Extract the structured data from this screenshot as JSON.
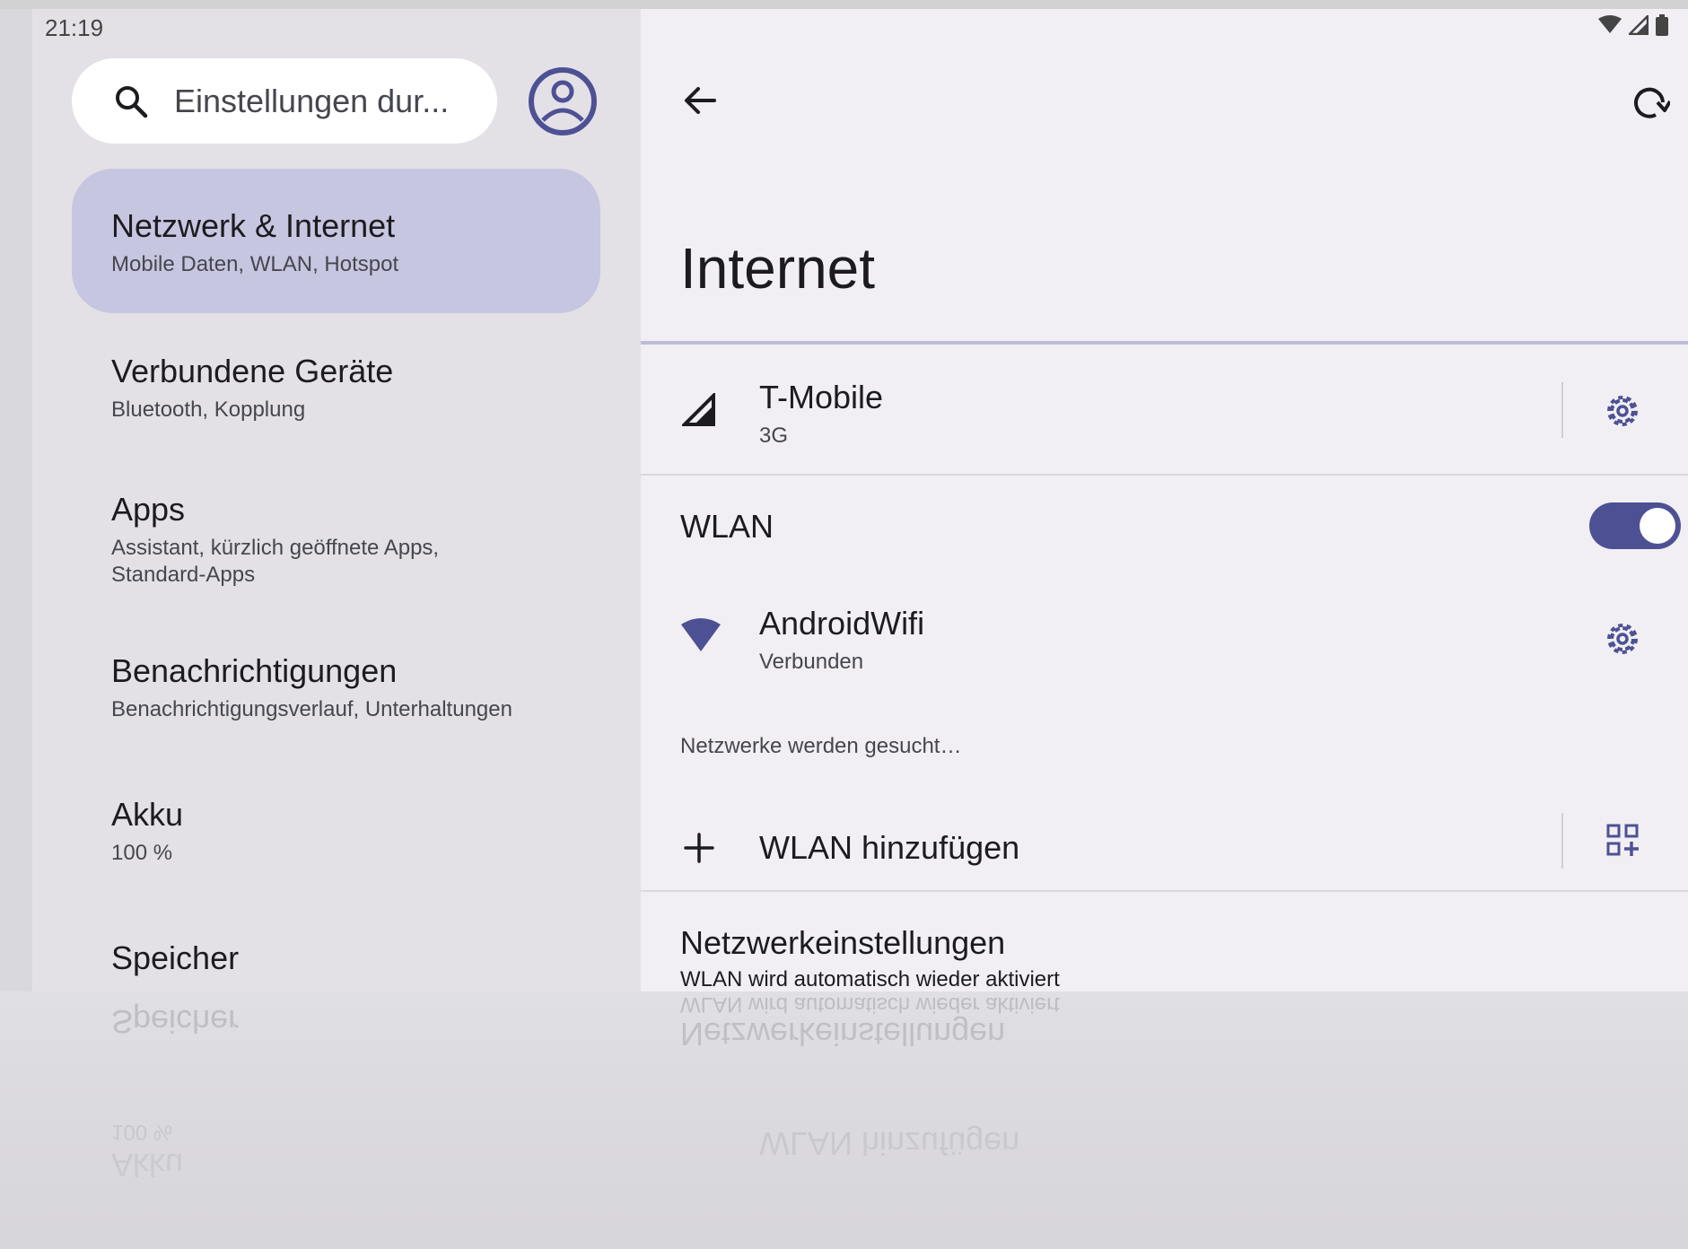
{
  "status_bar": {
    "time": "21:19",
    "icons": [
      "wifi-icon",
      "signal-icon",
      "battery-icon"
    ]
  },
  "search": {
    "placeholder": "Einstellungen dur...",
    "icon": "search-icon"
  },
  "account_icon": "account-circle-icon",
  "sidebar": {
    "items": [
      {
        "title": "Netzwerk & Internet",
        "subtitle": "Mobile Daten, WLAN, Hotspot",
        "active": true
      },
      {
        "title": "Verbundene Geräte",
        "subtitle": "Bluetooth, Kopplung"
      },
      {
        "title": "Apps",
        "subtitle_lines": [
          "Assistant, kürzlich geöffnete Apps,",
          "Standard-Apps"
        ]
      },
      {
        "title": "Benachrichtigungen",
        "subtitle": "Benachrichtigungsverlauf, Unterhaltungen"
      },
      {
        "title": "Akku",
        "subtitle": "100 %"
      },
      {
        "title": "Speicher"
      }
    ]
  },
  "main": {
    "title": "Internet",
    "mobile": {
      "name": "T-Mobile",
      "subtitle": "3G",
      "icon": "signal-icon",
      "settings_icon": "gear-icon"
    },
    "wlan": {
      "label": "WLAN",
      "enabled": true
    },
    "wifi_network": {
      "name": "AndroidWifi",
      "status": "Verbunden",
      "icon": "wifi-icon",
      "settings_icon": "gear-icon"
    },
    "scanning_text": "Netzwerke werden gesucht…",
    "add_wlan": {
      "label": "WLAN hinzufügen",
      "icon": "plus-icon",
      "qr_icon": "qr-code-scanner-icon"
    },
    "network_settings": {
      "title": "Netzwerkeinstellungen",
      "subtitle": "WLAN wird automatisch wieder aktiviert"
    }
  },
  "colors": {
    "accent": "#4d5194",
    "active_nav": "#c6c6e0",
    "left_pane": "#e3e1e6",
    "right_pane": "#f1eff4"
  }
}
